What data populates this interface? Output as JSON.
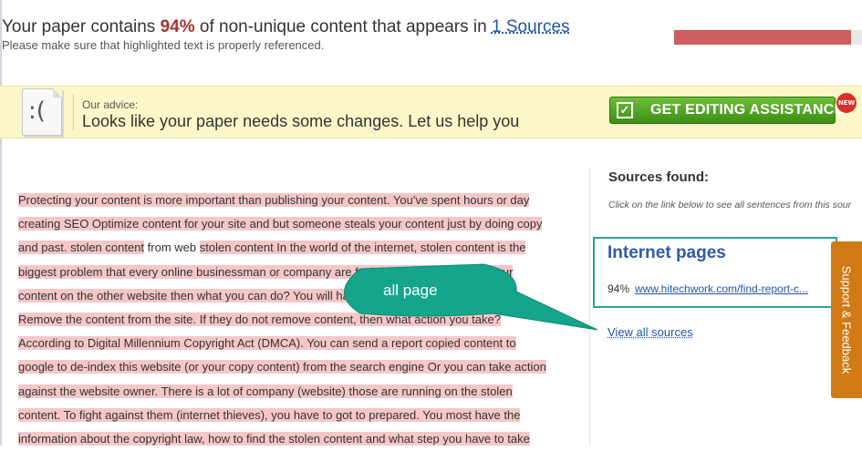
{
  "header": {
    "result_prefix": "Your paper contains",
    "percent": "94%",
    "result_middle": "of non-unique content that appears in",
    "sources_link": "1 Sources",
    "hint": "Please make sure that highlighted text is properly referenced.",
    "progress_fraction": 0.94
  },
  "advice": {
    "face": ":(",
    "label": "Our advice:",
    "text": "Looks like your paper needs some changes. Let us help you",
    "button_label": "GET EDITING ASSISTANCE",
    "badge": "NEW"
  },
  "content": {
    "lines": [
      [
        {
          "t": "Protecting your content is more important than publishing your content. You've spent hours or day",
          "hl": true
        }
      ],
      [
        {
          "t": "creating SEO Optimize content for your site and but someone steals your content just by doing copy",
          "hl": true
        }
      ],
      [
        {
          "t": "and past. stolen content",
          "hl": true
        },
        {
          "t": " from web ",
          "hl": false
        },
        {
          "t": "stolen content In the world of the internet, stolen content is the",
          "hl": true
        }
      ],
      [
        {
          "t": "biggest problem that every online businessman or company are facing today. If you found your",
          "hl": true
        }
      ],
      [
        {
          "t": "content on the other website then what you can do? You will have to request the site owner to",
          "hl": true
        }
      ],
      [
        {
          "t": "Remove the content from the site. If they do not remove content, then what action you take?",
          "hl": true
        }
      ],
      [
        {
          "t": "According to Digital Millennium Copyright Act (DMCA). You can send a report copied content to",
          "hl": true
        }
      ],
      [
        {
          "t": "google to de-index this website (or your copy content) from the search engine Or you can take action",
          "hl": true
        }
      ],
      [
        {
          "t": "against the website owner. There is a lot of company (website) those are running on the stolen",
          "hl": true
        }
      ],
      [
        {
          "t": "content. To fight against them (internet thieves), you have to got to prepared. You most have the",
          "hl": true
        }
      ],
      [
        {
          "t": "information about the copyright law, how to find the stolen content and what step you have to take",
          "hl": true
        }
      ]
    ]
  },
  "sources": {
    "title": "Sources found:",
    "hint": "Click on the link below to see all sentences from this sour",
    "pages_title": "Internet pages",
    "items": [
      {
        "percent": "94%",
        "url": "www.hitechwork.com/find-report-c..."
      }
    ],
    "view_all": "View all sources"
  },
  "callout": {
    "text": "all page",
    "color": "#14a58c"
  },
  "feedback_tab": {
    "label": "Support & Feedback",
    "color": "#d07a16"
  }
}
